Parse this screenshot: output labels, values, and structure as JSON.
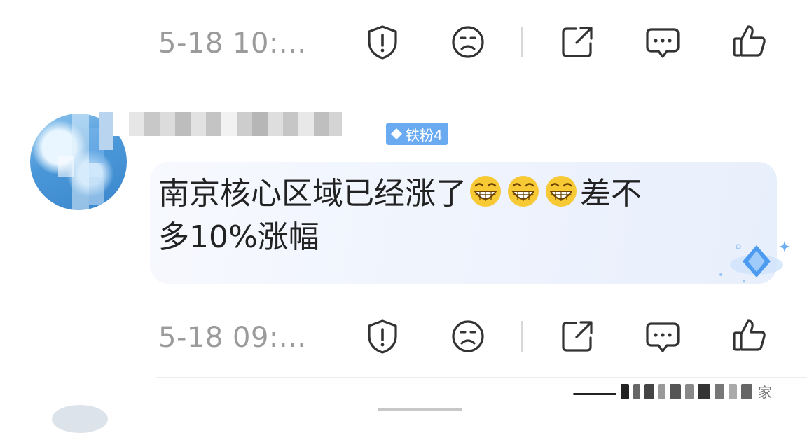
{
  "comment_prev": {
    "timestamp": "5-18 10:..."
  },
  "comment_main": {
    "username": "",
    "badge": {
      "label": "铁粉4",
      "color": "#6aaaf0"
    },
    "text_line1": "南京核心区域已经涨了",
    "emoji_name": "grinning-face",
    "emoji_count": 3,
    "text_line1_tail": "差不",
    "text_line2": "多10%涨幅",
    "timestamp": "5-18 09:..."
  },
  "actions": {
    "report": "report-icon",
    "dislike": "frown-icon",
    "share": "share-icon",
    "comment": "comment-icon",
    "like": "thumbs-up-icon"
  },
  "watermark": {
    "tail_char": "家"
  },
  "colors": {
    "timestamp": "#9b9b9b",
    "icon_stroke": "#333333",
    "divider": "#d8d8d8",
    "badge_bg": "#6aaaf0",
    "bubble_bg": "#eef3fd"
  }
}
